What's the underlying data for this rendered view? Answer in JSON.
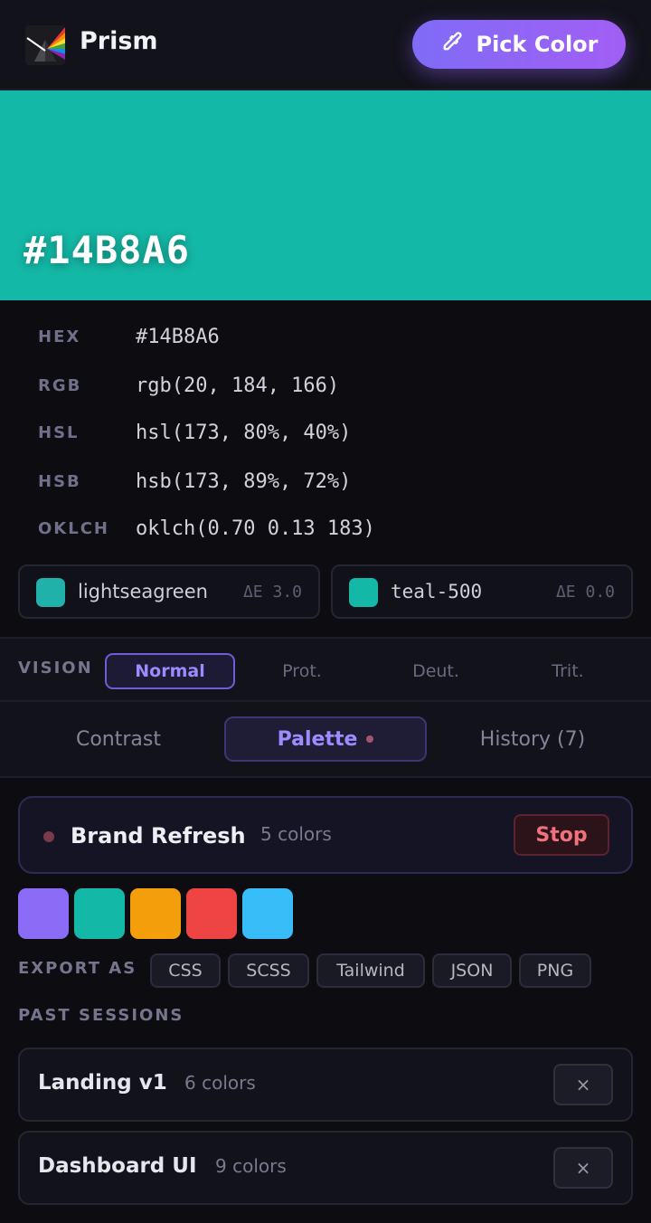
{
  "app": {
    "title": "Prism",
    "pick_label": "Pick Color"
  },
  "current": {
    "hex": "#14B8A6",
    "swatch_color": "#14B8A6"
  },
  "values": [
    {
      "label": "HEX",
      "value": "#14B8A6"
    },
    {
      "label": "RGB",
      "value": "rgb(20, 184, 166)"
    },
    {
      "label": "HSL",
      "value": "hsl(173, 80%, 40%)"
    },
    {
      "label": "HSB",
      "value": "hsb(173, 89%, 72%)"
    },
    {
      "label": "OKLCH",
      "value": "oklch(0.70 0.13 183)"
    }
  ],
  "matches": [
    {
      "name": "lightseagreen",
      "delta": "ΔE 3.0",
      "color": "#20B2AA"
    },
    {
      "name": "teal-500",
      "delta": "ΔE 0.0",
      "color": "#14B8A6"
    }
  ],
  "vision": {
    "label": "VISION",
    "modes": [
      "Normal",
      "Prot.",
      "Deut.",
      "Trit."
    ],
    "active": "Normal"
  },
  "tabs": [
    "Contrast",
    "Palette",
    "History (7)"
  ],
  "active_tab": "Palette",
  "session": {
    "name": "Brand Refresh",
    "count": "5 colors",
    "stop_label": "Stop"
  },
  "palette": [
    "#8B6CF6",
    "#14B8A6",
    "#F59E0B",
    "#EF4444",
    "#38BDF8"
  ],
  "export": {
    "label": "EXPORT AS",
    "formats": [
      "CSS",
      "SCSS",
      "Tailwind",
      "JSON",
      "PNG"
    ]
  },
  "past": {
    "label": "PAST SESSIONS",
    "sessions": [
      {
        "name": "Landing v1",
        "count": "6 colors",
        "remove": "×"
      },
      {
        "name": "Dashboard UI",
        "count": "9 colors",
        "remove": "×"
      }
    ]
  }
}
